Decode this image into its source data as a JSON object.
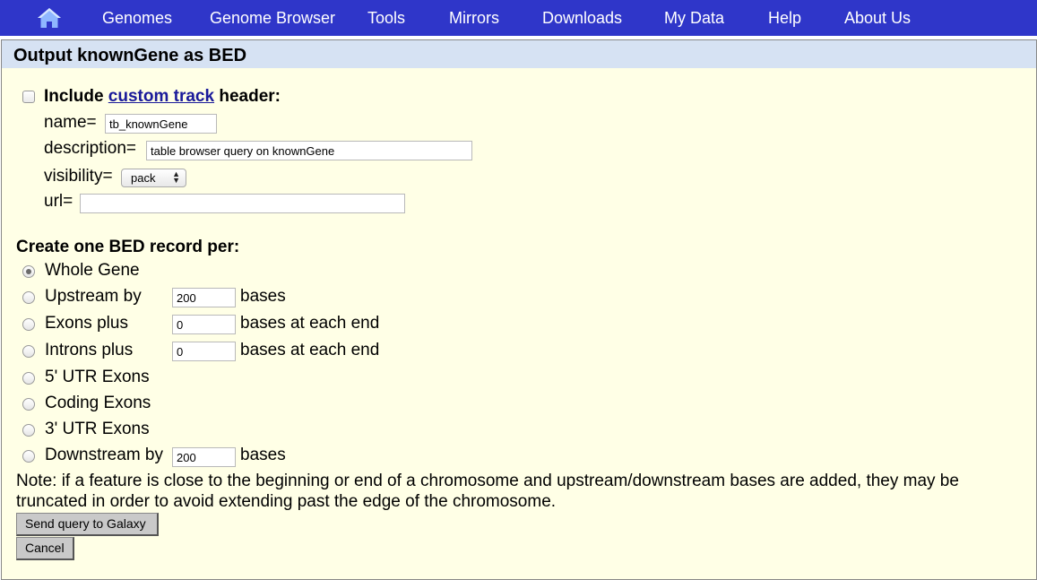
{
  "nav": {
    "home_icon": "home-icon",
    "items": [
      "Genomes",
      "Genome Browser",
      "Tools",
      "Mirrors",
      "Downloads",
      "My Data",
      "Help",
      "About Us"
    ]
  },
  "panel": {
    "title": "Output knownGene as BED"
  },
  "header_opts": {
    "include_prefix": "Include",
    "include_link": "custom track",
    "include_suffix": "header:",
    "name_label": "name=",
    "name_value": "tb_knownGene",
    "description_label": "description=",
    "description_value": "table browser query on knownGene",
    "visibility_label": "visibility=",
    "visibility_value": "pack",
    "url_label": "url=",
    "url_value": ""
  },
  "record": {
    "heading": "Create one BED record per:",
    "options": [
      {
        "label": "Whole Gene",
        "checked": true
      },
      {
        "label": "Upstream by",
        "value": "200",
        "suffix": "bases"
      },
      {
        "label": "Exons plus",
        "value": "0",
        "suffix": "bases at each end"
      },
      {
        "label": "Introns plus",
        "value": "0",
        "suffix": "bases at each end"
      },
      {
        "label": "5' UTR Exons"
      },
      {
        "label": "Coding Exons"
      },
      {
        "label": "3' UTR Exons"
      },
      {
        "label": "Downstream by",
        "value": "200",
        "suffix": "bases"
      }
    ]
  },
  "note_line1": "Note: if a feature is close to the beginning or end of a chromosome and upstream/downstream bases are added, they may be",
  "note_line2": "truncated in order to avoid extending past the edge of the chromosome.",
  "buttons": {
    "send": "Send query to Galaxy",
    "cancel": "Cancel"
  },
  "colors": {
    "nav_bg": "#2f36c9",
    "panel_bg": "#ffffe6",
    "panel_header_bg": "#d6e2f3",
    "link": "#1a1a9a"
  }
}
